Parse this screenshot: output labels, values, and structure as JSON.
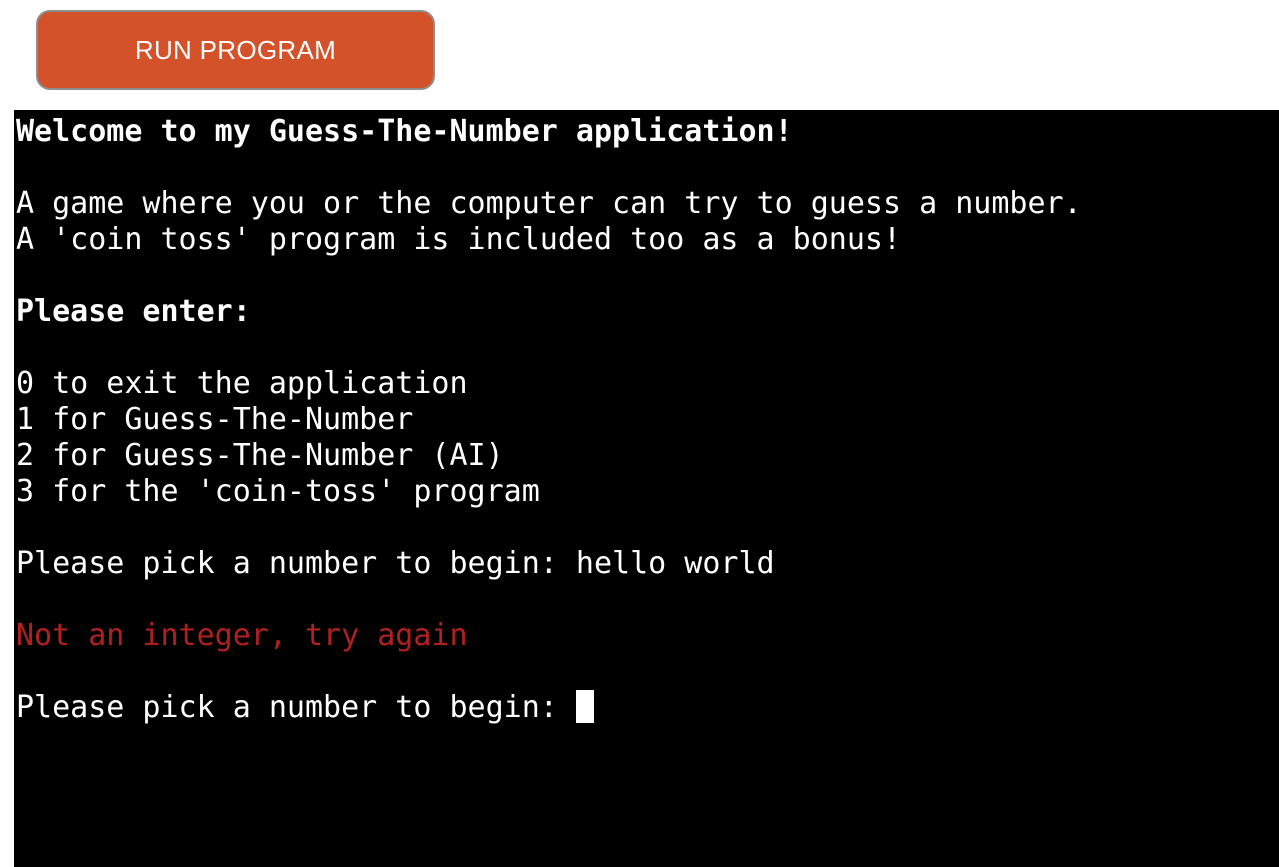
{
  "toolbar": {
    "run_button_label": "RUN PROGRAM",
    "button_color": "#d4522a",
    "button_border_color": "#8d8d8d",
    "button_text_color": "#ffffff"
  },
  "terminal": {
    "background": "#000000",
    "foreground": "#ffffff",
    "error_color": "#b02020",
    "cursor": {
      "style": "block",
      "color": "#ffffff",
      "visible": true
    },
    "lines": [
      {
        "text": "Welcome to my Guess-The-Number application!",
        "style": "bold"
      },
      {
        "text": "",
        "style": "blank"
      },
      {
        "text": "A game where you or the computer can try to guess a number.",
        "style": "normal"
      },
      {
        "text": "A 'coin toss' program is included too as a bonus!",
        "style": "normal"
      },
      {
        "text": "",
        "style": "blank"
      },
      {
        "text": "Please enter:",
        "style": "bold"
      },
      {
        "text": "",
        "style": "blank"
      },
      {
        "text": "0 to exit the application",
        "style": "normal"
      },
      {
        "text": "1 for Guess-The-Number",
        "style": "normal"
      },
      {
        "text": "2 for Guess-The-Number (AI)",
        "style": "normal"
      },
      {
        "text": "3 for the 'coin-toss' program",
        "style": "normal"
      },
      {
        "text": "",
        "style": "blank"
      },
      {
        "text": "Please pick a number to begin: hello world",
        "style": "normal"
      },
      {
        "text": "",
        "style": "blank"
      },
      {
        "text": "Not an integer, try again",
        "style": "error"
      },
      {
        "text": "",
        "style": "blank"
      }
    ],
    "active_prompt": "Please pick a number to begin: ",
    "entered_value": "hello world",
    "error_message": "Not an integer, try again",
    "menu_options": [
      {
        "key": "0",
        "label": "to exit the application"
      },
      {
        "key": "1",
        "label": "for Guess-The-Number"
      },
      {
        "key": "2",
        "label": "for Guess-The-Number (AI)"
      },
      {
        "key": "3",
        "label": "for the 'coin-toss' program"
      }
    ]
  }
}
